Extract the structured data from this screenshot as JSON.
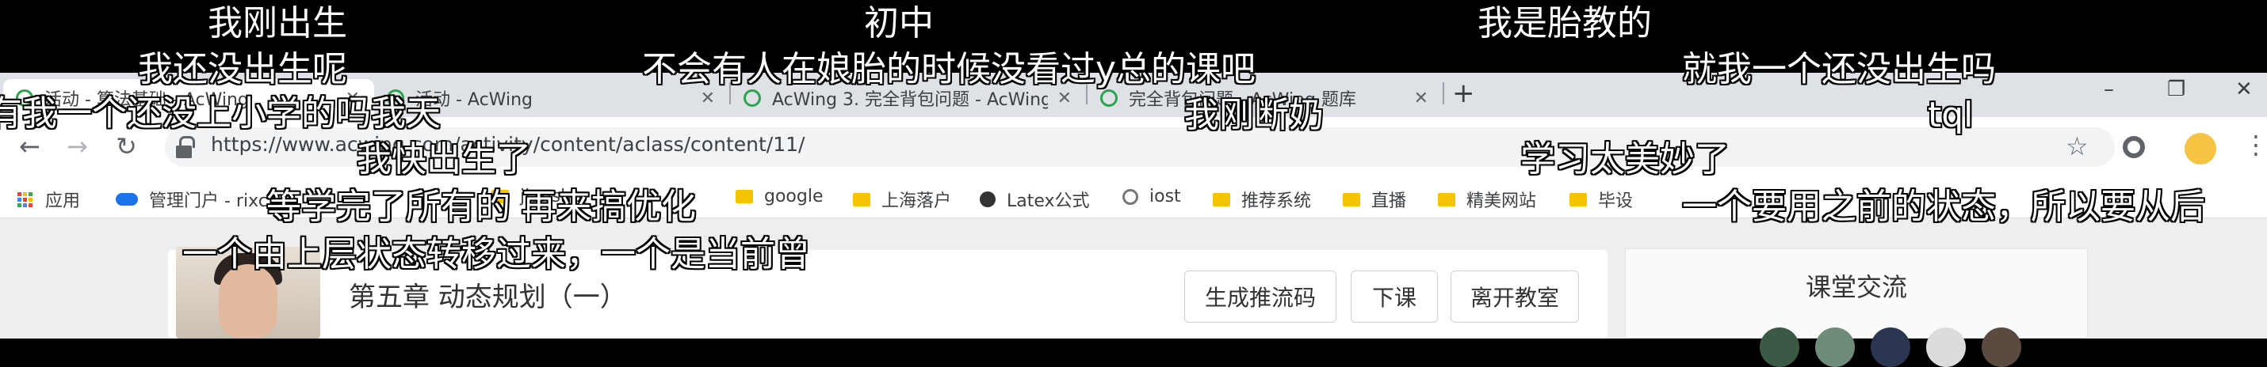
{
  "browser": {
    "tabs": [
      {
        "title": "活动 - 算法基础 - AcWing",
        "active": true
      },
      {
        "title": "活动 - AcWing",
        "active": false
      },
      {
        "title": "AcWing 3. 完全背包问题 - AcWing",
        "active": false
      },
      {
        "title": "完全背包问题 - AcWing 题库",
        "active": false
      }
    ],
    "new_tab": "+",
    "window_controls": {
      "minimize": "–",
      "restore": "❐",
      "close": "✕"
    },
    "url": "https://www.acwing.com/activity/content/aclass/content/11/",
    "bookmarks": [
      "应用",
      "管理门户 - rixc",
      "jianshu",
      "google",
      "上海落户",
      "Latex公式",
      "iost",
      "推荐系统",
      "直播",
      "精美网站",
      "毕设"
    ]
  },
  "page": {
    "chapter_title": "第五章 动态规划（一）",
    "buttons": {
      "stream": "生成推流码",
      "end_class": "下课",
      "leave": "离开教室"
    },
    "chat_title": "课堂交流"
  },
  "danmaku": [
    "我刚出生",
    "初中",
    "我是胎教的",
    "我还没出生呢",
    "不会有人在娘胎的时候没看过y总的课吧",
    "就我一个还没出生吗",
    "有我一个还没上小学的吗我天",
    "我刚断奶",
    "tql",
    "我快出生了",
    "学习太美妙了",
    "等学完了所有的 再来搞优化",
    "一个要用之前的状态，所以要从后",
    "一个由上层状态转移过来，一个是当前曾"
  ]
}
